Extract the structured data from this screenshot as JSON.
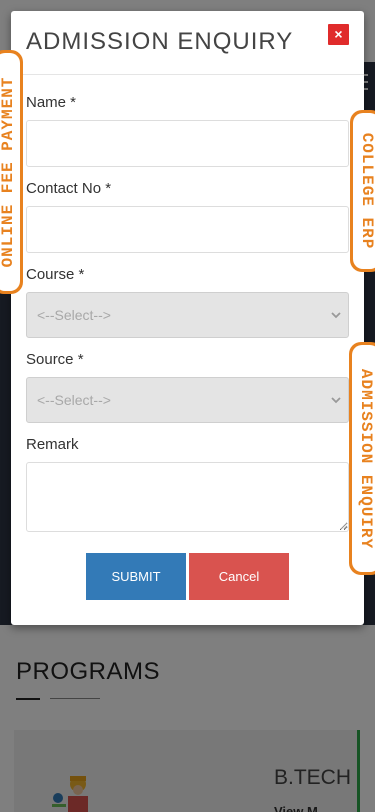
{
  "background": {
    "section_title": "PROGRAMS",
    "card_title": "B.TECH",
    "card_link": "View M"
  },
  "modal": {
    "title": "ADMISSION ENQUIRY",
    "close_label": "×",
    "fields": {
      "name": {
        "label": "Name *",
        "value": "",
        "placeholder": ""
      },
      "contact": {
        "label": "Contact No *",
        "value": "",
        "placeholder": ""
      },
      "course": {
        "label": "Course *",
        "selected": "<--Select-->"
      },
      "source": {
        "label": "Source *",
        "selected": "<--Select-->"
      },
      "remark": {
        "label": "Remark",
        "value": ""
      }
    },
    "submit_label": "SUBMIT",
    "cancel_label": "Cancel"
  },
  "side_tabs": {
    "left": "ONLINE FEE PAYMENT",
    "college": "COLLEGE ERP",
    "admission": "ADMISSION ENQUIRY"
  },
  "colors": {
    "accent_orange": "#e8821f",
    "submit_blue": "#337ab7",
    "cancel_red": "#d9534f",
    "close_red": "#e02b2b"
  },
  "icons": {
    "close": "close-icon",
    "dropdown": "chevron-down-icon",
    "menu": "hamburger-icon"
  }
}
